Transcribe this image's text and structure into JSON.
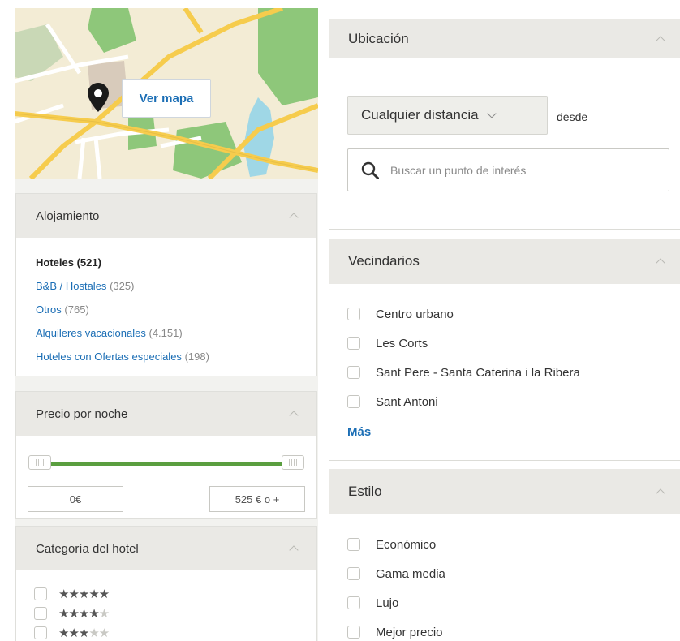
{
  "map": {
    "button_label": "Ver mapa"
  },
  "alojamiento": {
    "title": "Alojamiento",
    "items": [
      {
        "label": "Hoteles",
        "count": "(521)",
        "active": true
      },
      {
        "label": "B&B / Hostales",
        "count": "(325)"
      },
      {
        "label": "Otros",
        "count": "(765)"
      },
      {
        "label": "Alquileres vacacionales",
        "count": "(4.151)"
      },
      {
        "label": "Hoteles con Ofertas especiales",
        "count": "(198)"
      }
    ]
  },
  "precio": {
    "title": "Precio por noche",
    "min": "0€",
    "max": "525 € o +"
  },
  "categoria": {
    "title": "Categoría del hotel",
    "rows": [
      {
        "stars": 5
      },
      {
        "stars": 4
      },
      {
        "stars": 3
      }
    ]
  },
  "ubicacion": {
    "title": "Ubicación",
    "distance_label": "Cualquier distancia",
    "from_label": "desde",
    "search_placeholder": "Buscar un punto de interés"
  },
  "vecindarios": {
    "title": "Vecindarios",
    "items": [
      "Centro urbano",
      "Les Corts",
      "Sant Pere - Santa Caterina i la Ribera",
      "Sant Antoni"
    ],
    "more_label": "Más"
  },
  "estilo": {
    "title": "Estilo",
    "items": [
      "Económico",
      "Gama media",
      "Lujo",
      "Mejor precio"
    ]
  },
  "colors": {
    "link": "#1b6eb5",
    "slider": "#5a9e3f",
    "header_bg": "#eae9e5"
  }
}
